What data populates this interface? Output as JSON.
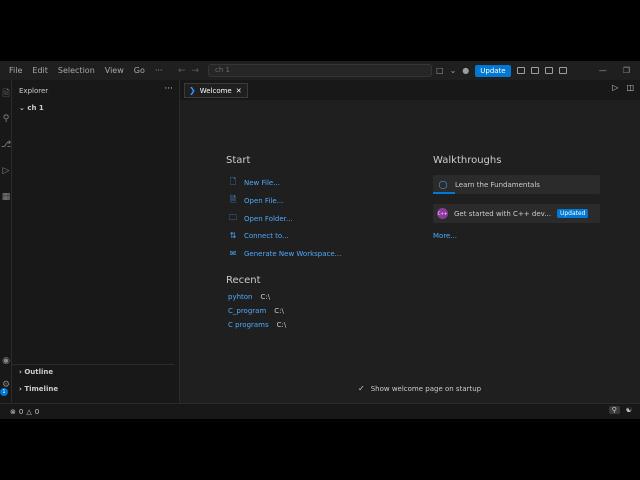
{
  "titlebar": {
    "menu": [
      "File",
      "Edit",
      "Selection",
      "View",
      "Go",
      "···"
    ],
    "command_center": "ch 1",
    "update_label": "Update"
  },
  "sidebar": {
    "title": "Explorer",
    "folder": "ch 1",
    "outline": "Outline",
    "timeline": "Timeline",
    "badge": "1"
  },
  "tab": {
    "label": "Welcome"
  },
  "welcome": {
    "start_heading": "Start",
    "start_items": [
      "New File...",
      "Open File...",
      "Open Folder...",
      "Connect to...",
      "Generate New Workspace..."
    ],
    "recent_heading": "Recent",
    "recent_items": [
      {
        "name": "pyhton",
        "path": "C:\\"
      },
      {
        "name": "C_program",
        "path": "C:\\"
      },
      {
        "name": "C programs",
        "path": "C:\\"
      }
    ],
    "walkthroughs_heading": "Walkthroughs",
    "walkthroughs": [
      {
        "label": "Learn the Fundamentals"
      },
      {
        "label": "Get started with C++ dev...",
        "badge": "Updated"
      }
    ],
    "more_label": "More...",
    "startup_label": "Show welcome page on startup"
  },
  "status": {
    "errors": "0",
    "warnings": "0"
  },
  "colors": {
    "accent": "#0078d4",
    "link": "#4daafc",
    "editor_bg": "#1f1f1f",
    "sidebar_bg": "#181818"
  }
}
